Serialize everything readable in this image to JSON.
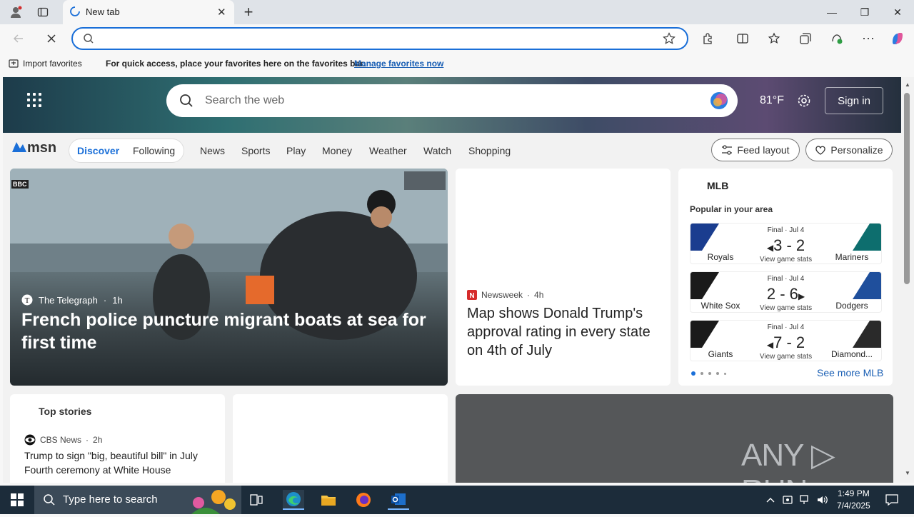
{
  "browser": {
    "tab_title": "New tab",
    "tab_close": "✕",
    "new_tab": "+",
    "window": {
      "minimize": "—",
      "restore": "❐",
      "close": "✕"
    }
  },
  "favorites_bar": {
    "import_label": "Import favorites",
    "message": "For quick access, place your favorites here on the favorites bar.",
    "manage_link": "Manage favorites now"
  },
  "hero": {
    "search_placeholder": "Search the web",
    "temperature": "81°F",
    "signin_label": "Sign in"
  },
  "msn_nav": {
    "logo": "msn",
    "pill": [
      "Discover",
      "Following"
    ],
    "links": [
      "News",
      "Sports",
      "Play",
      "Money",
      "Weather",
      "Watch",
      "Shopping"
    ],
    "feed_layout": "Feed layout",
    "personalize": "Personalize"
  },
  "big_story": {
    "badge": "BBC",
    "source": "The Telegraph",
    "age": "1h",
    "headline": "French police puncture migrant boats at sea for first time"
  },
  "newsweek_story": {
    "source": "Newsweek",
    "age": "4h",
    "headline": "Map shows Donald Trump's approval rating in every state on 4th of July"
  },
  "mlb": {
    "title": "MLB",
    "subtitle": "Popular in your area",
    "games": [
      {
        "status": "Final · Jul 4",
        "score": "3 - 2",
        "winner_arrow": "left",
        "link": "View game stats",
        "team1": "Royals",
        "team2": "Mariners",
        "color1": "#1a3d8f",
        "color2": "#0d6e6e"
      },
      {
        "status": "Final · Jul 4",
        "score": "2 - 6",
        "winner_arrow": "right",
        "link": "View game stats",
        "team1": "White Sox",
        "team2": "Dodgers",
        "color1": "#1a1a1a",
        "color2": "#1f4f9c"
      },
      {
        "status": "Final · Jul 4",
        "score": "7 - 2",
        "winner_arrow": "left",
        "link": "View game stats",
        "team1": "Giants",
        "team2": "Diamond...",
        "color1": "#1a1a1a",
        "color2": "#2a2a2a"
      }
    ],
    "see_more": "See more MLB"
  },
  "top_stories": {
    "title": "Top stories",
    "source": "CBS News",
    "age": "2h",
    "headline": "Trump to sign \"big, beautiful bill\" in July Fourth ceremony at White House"
  },
  "watermark": "ANY ▷ RUN",
  "taskbar": {
    "search_placeholder": "Type here to search",
    "time": "1:49 PM",
    "date": "7/4/2025"
  }
}
